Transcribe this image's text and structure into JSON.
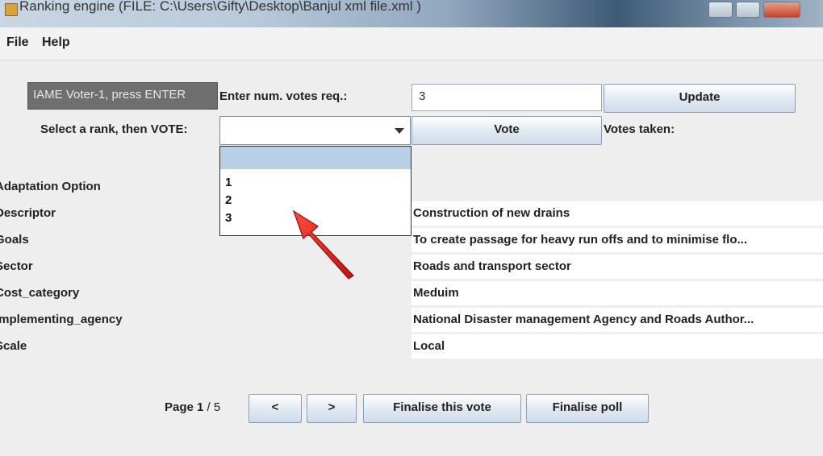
{
  "window": {
    "title": "Ranking engine  (FILE: C:\\Users\\Gifty\\Desktop\\Banjul xml file.xml )"
  },
  "menu": {
    "items": [
      "File",
      "Help"
    ]
  },
  "form": {
    "name_field_value": "IAME Voter-1, press ENTER",
    "num_votes_label": "Enter num. votes req.:",
    "num_votes_value": "3",
    "update_label": "Update",
    "rank_label": "Select a rank, then VOTE:",
    "vote_label": "Vote",
    "votes_taken_label": "Votes taken:"
  },
  "rank_dropdown": {
    "options": [
      "",
      "1",
      "2",
      "3"
    ]
  },
  "attributes": [
    {
      "name": "Adaptation Option",
      "value": ""
    },
    {
      "name": "Descriptor",
      "value": "Construction of new drains"
    },
    {
      "name": "Goals",
      "value": "To create passage for heavy run offs and to minimise flo..."
    },
    {
      "name": "Sector",
      "value": "Roads and transport sector"
    },
    {
      "name": "Cost_category",
      "value": "Meduim"
    },
    {
      "name": "Implementing_agency",
      "value": "National Disaster management Agency and Roads Author..."
    },
    {
      "name": "Scale",
      "value": "Local"
    }
  ],
  "footer": {
    "page_label": "Page",
    "page_current": "1",
    "page_total": "/ 5",
    "prev_label": "<",
    "next_label": ">",
    "finalise_vote_label": "Finalise this vote",
    "finalise_poll_label": "Finalise poll"
  },
  "colors": {
    "annotation_arrow": "#e02020",
    "selection": "#b8cfe5"
  }
}
